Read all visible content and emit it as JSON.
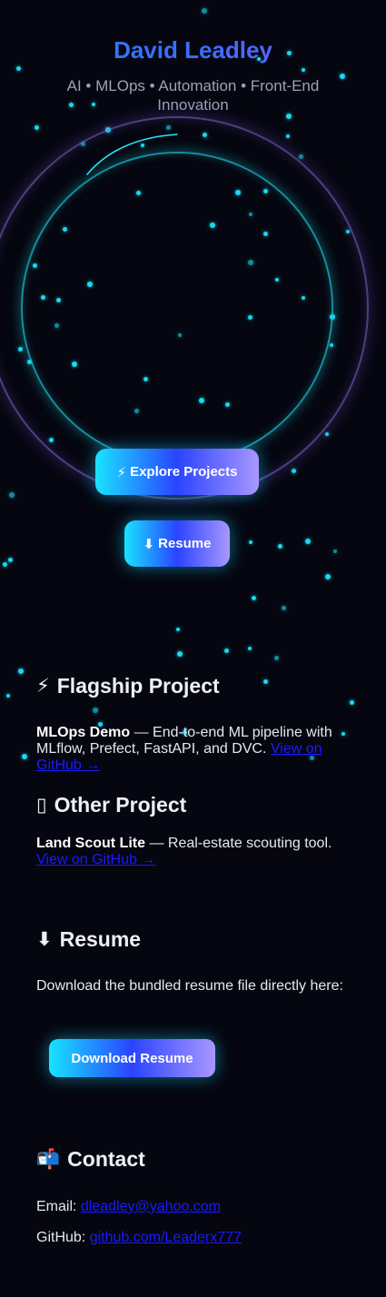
{
  "hero": {
    "name": "David Leadley",
    "tagline": "AI • MLOps • Automation • Front-End Innovation",
    "explore_label": "Explore Projects",
    "explore_icon": "⚡",
    "resume_label": "Resume",
    "resume_icon": "⬇"
  },
  "flagship": {
    "icon": "⚡",
    "heading": "Flagship Project",
    "project_name": "MLOps Demo",
    "description": " — End-to-end ML pipeline with MLflow, Prefect, FastAPI, and DVC. ",
    "link_text": "View on GitHub →"
  },
  "other": {
    "icon": "▯",
    "heading": "Other Project",
    "project_name": "Land Scout Lite",
    "description": " — Real-estate scouting tool. ",
    "link_text": "View on GitHub →"
  },
  "resume": {
    "icon": "⬇",
    "heading": "Resume",
    "text": "Download the bundled resume file directly here:",
    "button_label": "Download Resume"
  },
  "contact": {
    "icon": "📬",
    "heading": "Contact",
    "email_label": "Email: ",
    "email": "dleadley@yahoo.com",
    "github_label": "GitHub: ",
    "github": "github.com/Leaderx777"
  },
  "colors": {
    "background": "#05060f",
    "star": "#19e6ff",
    "link": "#1a1aff",
    "gradient_start": "#19e3ff",
    "gradient_mid": "#2a44ff",
    "gradient_end": "#a897ff"
  }
}
